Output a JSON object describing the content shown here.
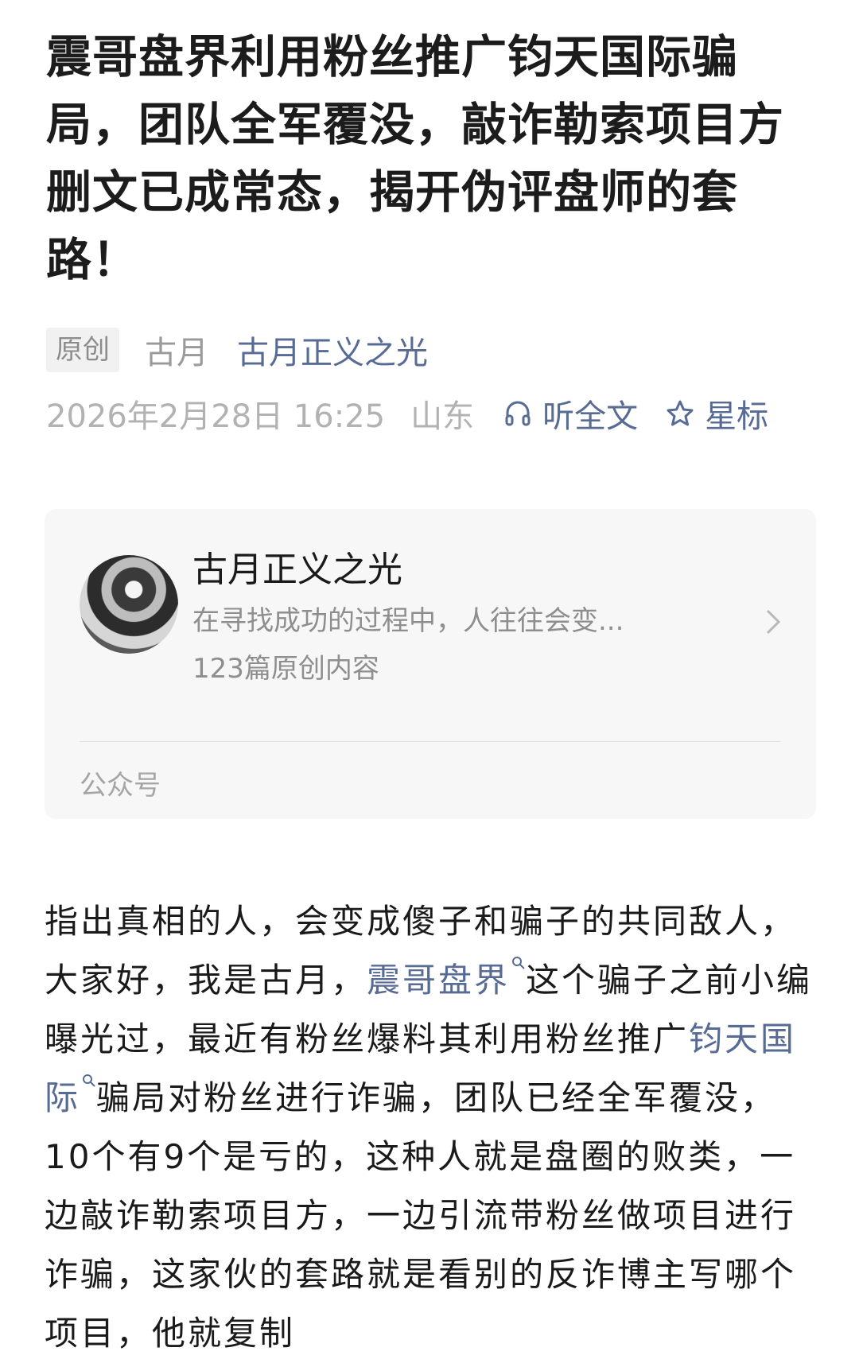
{
  "article": {
    "title": "震哥盘界利用粉丝推广钧天国际骗局，团队全军覆没，敲诈勒索项目方删文已成常态，揭开伪评盘师的套路！",
    "original_badge": "原创",
    "author": "古月",
    "account_name": "古月正义之光",
    "date": "2026年2月28日 16:25",
    "location": "山东",
    "listen_label": "听全文",
    "star_label": "星标"
  },
  "card": {
    "name": "古月正义之光",
    "description": "在寻找成功的过程中，人往往会变...",
    "count": "123篇原创内容",
    "footer": "公众号"
  },
  "body": {
    "p1_a": "指出真相的人，会变成傻子和骗子的共同敌人，大家好，我是古月，",
    "link1": "震哥盘界",
    "p1_b": "这个骗子之前小编曝光过，最近有粉丝爆料其利用粉丝推广",
    "link2": "钧天国际",
    "p1_c": "骗局对粉丝进行诈骗，团队已经全军覆没，10个有9个是亏的，这种人就是盘圈的败类，一边敲诈勒索项目方，一边引流带粉丝做项目进行诈骗，这家伙的套路就是看别的反诈博主写哪个项目，他就复制"
  },
  "colors": {
    "link": "#576b95",
    "meta_gray": "#b2b2b2",
    "card_bg": "#f7f7f7"
  },
  "icons": {
    "listen": "headphones-icon",
    "star": "star-icon",
    "chevron": "chevron-right-icon",
    "search": "search-icon"
  }
}
